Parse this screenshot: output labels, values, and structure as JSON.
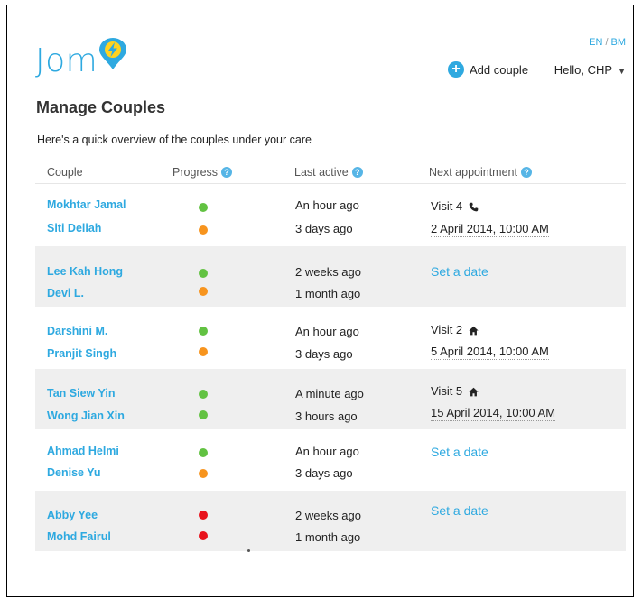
{
  "logo": {
    "text": "Jom"
  },
  "lang": {
    "en": "EN",
    "sep": "/",
    "bm": "BM"
  },
  "header": {
    "add_couple": "Add couple",
    "greeting": "Hello, CHP",
    "caret": "▼"
  },
  "page": {
    "title": "Manage Couples",
    "subtitle": "Here's a quick overview of the couples under your care"
  },
  "columns": {
    "couple": "Couple",
    "progress": "Progress",
    "last_active": "Last active",
    "next_appointment": "Next appointment"
  },
  "help_glyph": "?",
  "couples": [
    {
      "people": [
        {
          "name": "Mokhtar Jamal",
          "status": "green",
          "last_active": "An hour ago"
        },
        {
          "name": "Siti Deliah",
          "status": "orange",
          "last_active": "3 days ago"
        }
      ],
      "appointment": {
        "visit": "Visit 4",
        "icon": "phone-icon",
        "date": "2 April 2014, 10:00 AM"
      }
    },
    {
      "people": [
        {
          "name": "Lee Kah Hong",
          "status": "green",
          "last_active": "2 weeks ago"
        },
        {
          "name": "Devi L.",
          "status": "orange",
          "last_active": "1 month ago"
        }
      ],
      "set_date": "Set a date"
    },
    {
      "people": [
        {
          "name": "Darshini M.",
          "status": "green",
          "last_active": "An hour ago"
        },
        {
          "name": "Pranjit Singh",
          "status": "orange",
          "last_active": "3 days ago"
        }
      ],
      "appointment": {
        "visit": "Visit 2",
        "icon": "home-icon",
        "date": "5 April 2014, 10:00 AM"
      }
    },
    {
      "people": [
        {
          "name": "Tan Siew Yin",
          "status": "green",
          "last_active": "A minute ago"
        },
        {
          "name": "Wong Jian Xin",
          "status": "green",
          "last_active": "3 hours ago"
        }
      ],
      "appointment": {
        "visit": "Visit 5",
        "icon": "home-icon",
        "date": "15 April 2014, 10:00 AM"
      }
    },
    {
      "people": [
        {
          "name": "Ahmad Helmi",
          "status": "green",
          "last_active": "An hour ago"
        },
        {
          "name": "Denise Yu",
          "status": "orange",
          "last_active": "3 days ago"
        }
      ],
      "set_date": "Set a date"
    },
    {
      "people": [
        {
          "name": "Abby Yee",
          "status": "red",
          "last_active": "2 weeks ago"
        },
        {
          "name": "Mohd Fairul",
          "status": "red",
          "last_active": "1 month ago"
        }
      ],
      "set_date": "Set a date"
    }
  ],
  "colors": {
    "brand": "#2ea9e0",
    "green": "#62c242",
    "orange": "#f7941e",
    "red": "#e8121c"
  }
}
